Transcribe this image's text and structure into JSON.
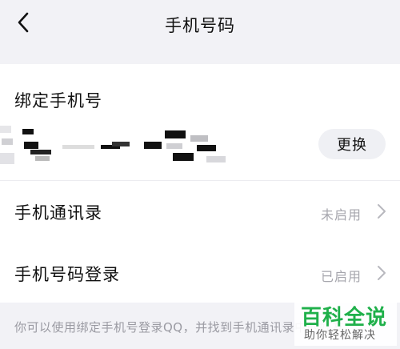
{
  "header": {
    "title": "手机号码",
    "back_icon": "chevron-left-icon"
  },
  "binding": {
    "title": "绑定手机号",
    "change_label": "更换"
  },
  "rows": [
    {
      "label": "手机通讯录",
      "status": "未启用",
      "icon": "chevron-right-icon"
    },
    {
      "label": "手机号码登录",
      "status": "已启用",
      "icon": "chevron-right-icon"
    }
  ],
  "footer": {
    "note": "你可以使用绑定手机号登录QQ，并找到手机通讯录中的好友。"
  },
  "watermark": {
    "main": "百科全说",
    "sub": "助你轻松解决"
  },
  "colors": {
    "background": "#f2f2f6",
    "card": "#ffffff",
    "status_text": "#a6a6ad",
    "watermark_green": "#1fb04a"
  }
}
